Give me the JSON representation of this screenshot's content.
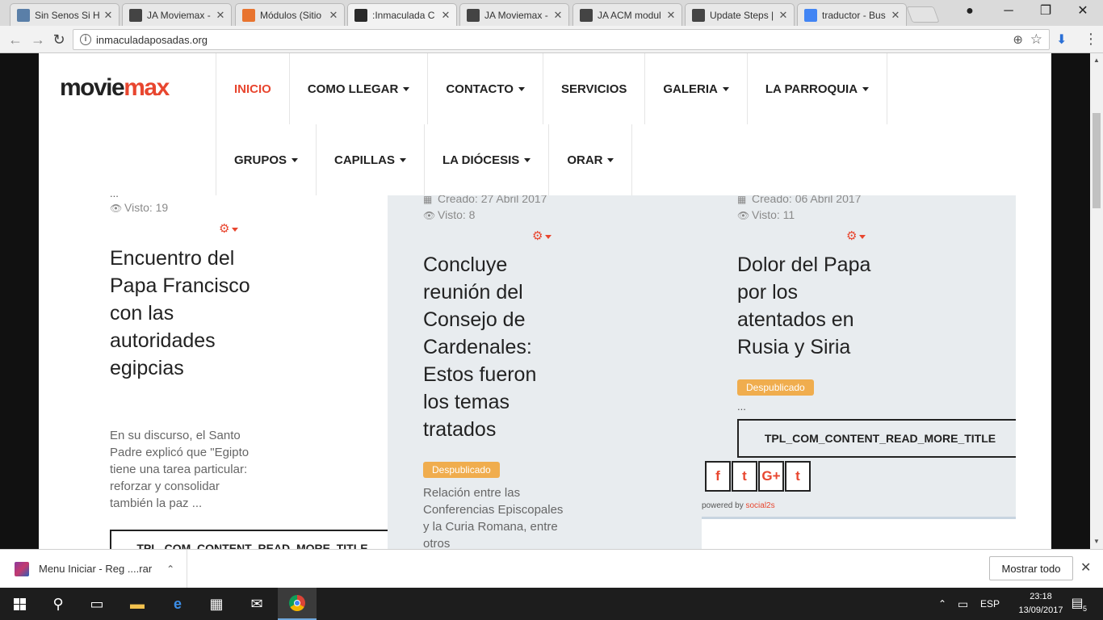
{
  "browser": {
    "tabs": [
      {
        "label": "Sin Senos Si H",
        "favicon_color": "#5a7fa8"
      },
      {
        "label": "JA Moviemax -",
        "favicon_color": "#444444"
      },
      {
        "label": "Módulos (Sitio",
        "favicon_color": "#e8742f"
      },
      {
        "label": ":Inmaculada C",
        "favicon_color": "#2a2a2a",
        "active": true
      },
      {
        "label": "JA Moviemax -",
        "favicon_color": "#444444"
      },
      {
        "label": "JA ACM modul",
        "favicon_color": "#444444"
      },
      {
        "label": "Update Steps |",
        "favicon_color": "#444444"
      },
      {
        "label": "traductor - Bus",
        "favicon_color": "#4285f4"
      }
    ],
    "url": "inmaculadaposadas.org",
    "win": {
      "minimize": "─",
      "restore": "❐",
      "close": "✕"
    }
  },
  "site": {
    "logo_main": "movie",
    "logo_accent": "max",
    "nav_row1": [
      {
        "label": "INICIO",
        "active": true,
        "caret": false
      },
      {
        "label": "COMO LLEGAR",
        "caret": true
      },
      {
        "label": "CONTACTO",
        "caret": true
      },
      {
        "label": "SERVICIOS",
        "caret": false
      },
      {
        "label": "GALERIA",
        "caret": true
      },
      {
        "label": "LA PARROQUIA",
        "caret": true
      }
    ],
    "nav_row2": [
      {
        "label": "GRUPOS",
        "caret": true
      },
      {
        "label": "CAPILLAS",
        "caret": true
      },
      {
        "label": "LA DIÓCESIS",
        "caret": true
      },
      {
        "label": "ORAR",
        "caret": true
      }
    ]
  },
  "articles": [
    {
      "top_ellipsis": "...",
      "views": "Visto: 19",
      "title": "Encuentro del Papa Francisco con las autoridades egipcias",
      "intro": "En su discurso, el Santo Padre explicó que \"Egipto tiene una tarea particular: reforzar y consolidar también la paz ...",
      "read_more": "TPL_COM_CONTENT_READ_MORE_TITLE"
    },
    {
      "created": "Creado: 27 Abril 2017",
      "views": "Visto: 8",
      "title": "Concluye reunión del Consejo de Cardenales: Estos fueron los temas tratados",
      "badge": "Despublicado",
      "intro": "Relación entre las Conferencias Episcopales y la Curia Romana, entre otros"
    },
    {
      "created": "Creado: 06 Abril 2017",
      "views": "Visto: 11",
      "title": "Dolor del Papa por los atentados en Rusia y Siria",
      "badge": "Despublicado",
      "ellipsis": "...",
      "read_more": "TPL_COM_CONTENT_READ_MORE_TITLE",
      "social": [
        "f",
        "t",
        "G+",
        "t"
      ],
      "powered_prefix": "powered by",
      "powered_brand": "social2s"
    }
  ],
  "download": {
    "file": "Menu Iniciar - Reg ....rar",
    "show_all": "Mostrar todo"
  },
  "taskbar": {
    "lang": "ESP",
    "time": "23:18",
    "date": "13/09/2017",
    "notif_count": "5"
  }
}
